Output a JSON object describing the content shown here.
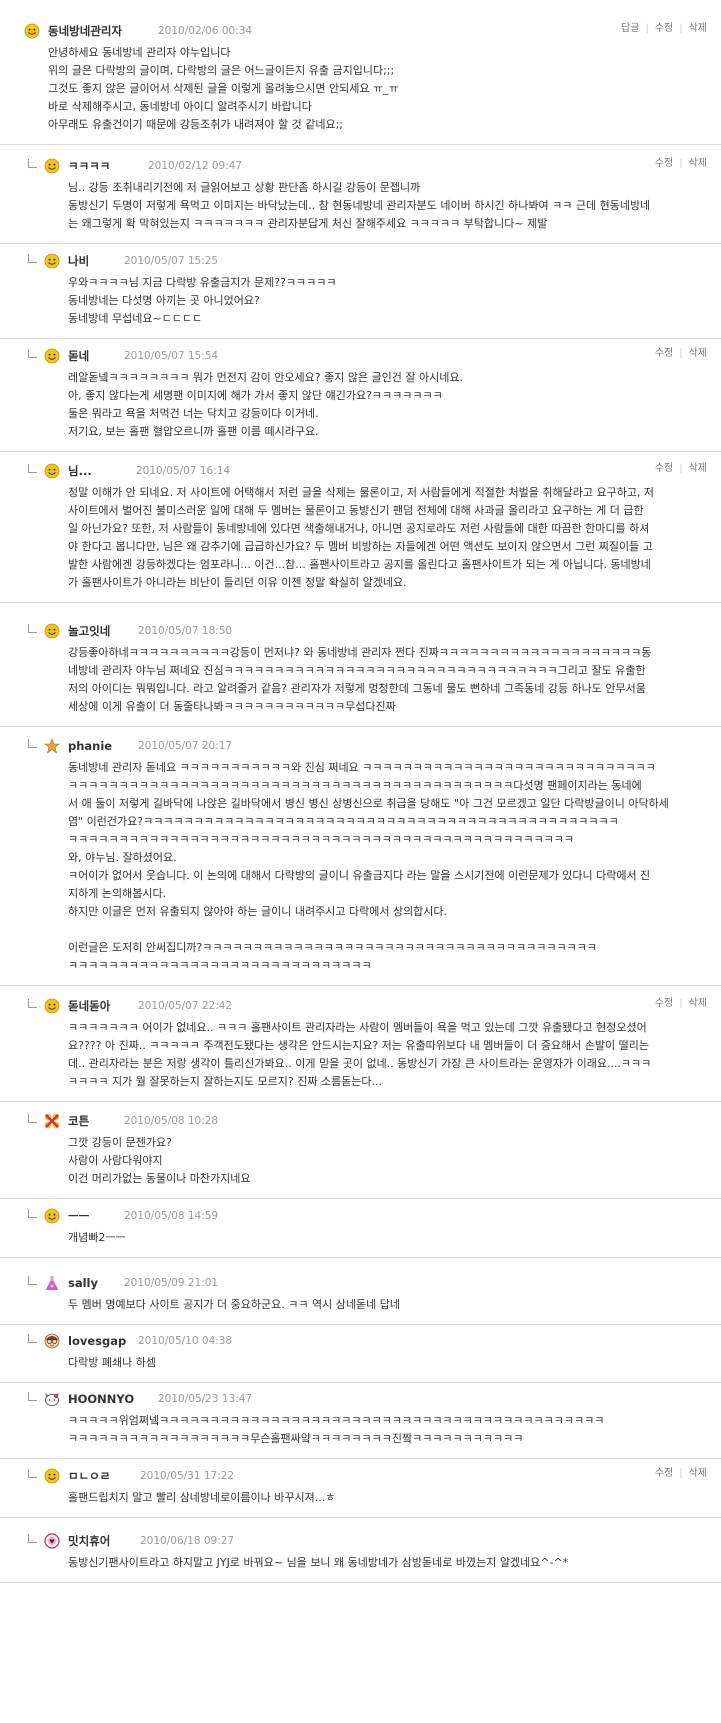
{
  "comments": [
    {
      "author": "동네방네관리자",
      "date": "2010/02/06 00:34",
      "avatar": "smiley-icon",
      "actions": [
        "답글",
        "수정",
        "삭제"
      ],
      "lines": [
        "안녕하세요 동네방네 관리자 야누입니다",
        "위의 글은 다락방의 글이며, 다락방의 글은 어느글이든지 유출 금지입니다;;;",
        "그것도 좋지 않은 글이어서 삭제된 글을 이렇게 올려놓으시면 안되세요 ㅠ_ㅠ",
        "바로 삭제해주시고, 동네방네 아이디 알려주시기 바랍니다",
        "아무래도 유출건이기 때문에 강등조취가 내려져야 할 것 같네요;;"
      ]
    },
    {
      "author": "ㅋㅋㅋㅋ",
      "date": "2010/02/12 09:47",
      "avatar": "smiley-icon",
      "actions": [
        "수정",
        "삭제"
      ],
      "lines": [
        "님.. 강등 조취내리기전에 저 글읽어보고 상황 판단좀 하시길 강등이 문젭니까",
        "동방신기 두명이 저렇게 욕먹고 이미지는 바닥났는데.. 참 현동네방네 관리자분도 네이버 하시긴 하나봐여 ㅋㅋ 근데 현동네방네",
        "는 왜그렇게 확 막혀있는지 ㅋㅋㅋㅋㅋㅋㅋ 관리자분답게 처신 잘해주세요 ㅋㅋㅋㅋㅋ 부탁합니다~ 제발"
      ]
    },
    {
      "author": "나비",
      "date": "2010/05/07 15:25",
      "avatar": "smiley-icon",
      "actions": [],
      "lines": [
        "우와ㅋㅋㅋㅋ님 지금 다락방 유출금지가 문제??ㅋㅋㅋㅋㅋ",
        "동네방네는 다섯명 아끼는 곳 아니었어요?",
        "동네방네 무섭네요~ㄷㄷㄷㄷ"
      ]
    },
    {
      "author": "돋네",
      "date": "2010/05/07 15:54",
      "avatar": "smiley-icon",
      "actions": [
        "수정",
        "삭제"
      ],
      "lines": [
        "레알돋넼ㅋㅋㅋㅋㅋㅋㅋㅋ 뭐가 먼전지 감이 안오세요? 좋지 않은 글인건 잘 아시네요.",
        "아, 좋지 않다는게 세명팬 이미지에 해가 가서 좋지 않단 얘긴가요?ㅋㅋㅋㅋㅋㅋㅋ",
        "둘은 뭐라고 욕을 처먹건 너는 닥치고 강등이다 이거네.",
        "저기요, 보는 홀팬 혈압오르니까 홀팬 이름 떼시라구요."
      ]
    },
    {
      "author": "님...",
      "date": "2010/05/07 16:14",
      "avatar": "smiley-icon",
      "actions": [
        "수정",
        "삭제"
      ],
      "lines": [
        "정말 이해가 안 되네요. 저 사이트에 어택해서 저런 글을 삭제는 물론이고, 저 사람들에게 적절한 처벌을 취해달라고 요구하고, 저",
        "사이트에서 벌어진 불미스러운 일에 대해 두 멤버는 물론이고 동방신기 팬덤 전체에 대해 사과글 올리라고 요구하는 게 더 급한",
        "일 아닌가요? 또한, 저 사람들이 동네방네에 있다면 색출해내거나, 아니면 공지로라도 저런 사람들에 대한 따끔한 한마디를 하셔",
        "야 한다고 봅니다만, 님은 왜 감추기에 급급하신가요? 두 멤버 비방하는 자들에겐 어떤 액션도 보이지 않으면서 그런 찌질이들 고",
        "발한 사람에겐 강등하겠다는 엄포라니... 이건...참... 홀팬사이트라고 공지를 올린다고 홀팬사이트가 되는 게 아닙니다. 동네방네",
        "가 홀팬사이트가 아니라는 비난이 들리던 이유 이젠 정말 확실히 알겠네요."
      ]
    },
    {
      "author": "놀고잇네",
      "date": "2010/05/07 18:50",
      "avatar": "smiley-icon",
      "actions": [],
      "lines": [
        "강등좋아하네ㅋㅋㅋㅋㅋㅋㅋㅋㅋㅋ강등이 먼저냐? 와 동네방네 관리자 쩐다 진짜ㅋㅋㅋㅋㅋㅋㅋㅋㅋㅋㅋㅋㅋㅋㅋㅋㅋㅋㅋㅋ동",
        "네방네 관리자 야누님 쩌네요 진심ㅋㅋㅋㅋㅋㅋㅋㅋㅋㅋㅋㅋㅋㅋㅋㅋㅋㅋㅋㅋㅋㅋㅋㅋㅋㅋㅋㅋㅋㅋㅋㅋㅋ그리고 잘도 유출한",
        "저의 아이디는 뭐뭐입니다. 라고 알려줄거 같음? 관리자가 저렇게 멍청한데 그동네 물도 뻔하네 그족동네 강등 하나도 안무서움",
        "세상에 이게 유출이 더 동줄타나봐ㅋㅋㅋㅋㅋㅋㅋㅋㅋㅋㅋㅋ무섭다진짜"
      ]
    },
    {
      "author": "phanie",
      "date": "2010/05/07 20:17",
      "avatar": "star-icon",
      "actions": [],
      "lines": [
        "동네방네 관리자 돋네요 ㅋㅋㅋㅋㅋㅋㅋㅋㅋㅋㅋ와 진심 쩌네요 ㅋㅋㅋㅋㅋㅋㅋㅋㅋㅋㅋㅋㅋㅋㅋㅋㅋㅋㅋㅋㅋㅋㅋㅋㅋㅋㅋㅋㅋ",
        "ㅋㅋㅋㅋㅋㅋㅋㅋㅋㅋㅋㅋㅋㅋㅋㅋㅋㅋㅋㅋㅋㅋㅋㅋㅋㅋㅋㅋㅋㅋㅋㅋㅋㅋㅋㅋㅋㅋㅋㅋㅋㅋㅋㅋ다섯명 팬페이지라는 동네에",
        "서 애 둘이 저렇게 길바닥에 나앉은 길바닥에서 병신 병신 상병신으로 취급을 당해도 \"아 그건 모르겠고 일단 다락방글이니 아닥하세",
        "염\" 이런건가요?ㅋㅋㅋㅋㅋㅋㅋㅋㅋㅋㅋㅋㅋㅋㅋㅋㅋㅋㅋㅋㅋㅋㅋㅋㅋㅋㅋㅋㅋㅋㅋㅋㅋㅋㅋㅋㅋㅋㅋㅋㅋㅋㅋㅋㅋㅋㅋ",
        "ㅋㅋㅋㅋㅋㅋㅋㅋㅋㅋㅋㅋㅋㅋㅋㅋㅋㅋㅋㅋㅋㅋㅋㅋㅋㅋㅋㅋㅋㅋㅋㅋㅋㅋㅋㅋㅋㅋㅋㅋㅋㅋㅋㅋㅋㅋㅋㅋㅋㅋ",
        "와, 야누님. 잘하셨어요.",
        "ㅋ어이가 없어서 웃습니다. 이 논의에 대해서 다락방의 글이니 유출금지다 라는 말을 스시기전에 이런문제가 있다니 다락에서 진",
        "지하게 논의해봅시다.",
        "하지만 이글은 먼저 유출되지 않아야 하는 글이니 내려주시고 다락에서 상의합시다.",
        "",
        "이런글은 도저히 안써집디까?ㅋㅋㅋㅋㅋㅋㅋㅋㅋㅋㅋㅋㅋㅋㅋㅋㅋㅋㅋㅋㅋㅋㅋㅋㅋㅋㅋㅋㅋㅋㅋㅋㅋㅋㅋㅋㅋㅋㅋ",
        "ㅋㅋㅋㅋㅋㅋㅋㅋㅋㅋㅋㅋㅋㅋㅋㅋㅋㅋㅋㅋㅋㅋㅋㅋㅋㅋㅋㅋㅋㅋ"
      ]
    },
    {
      "author": "돋네돋아",
      "date": "2010/05/07 22:42",
      "avatar": "smiley-icon",
      "actions": [
        "수정",
        "삭제"
      ],
      "lines": [
        "ㅋㅋㅋㅋㅋㅋㅋ 어이가 없네요.. ㅋㅋㅋ 홀팬사이트 관리자라는 사람이 멤버들이 욕을 먹고 있는데 그깟 유출됐다고 현정오셨어",
        "요???? 아 진짜.. ㅋㅋㅋㅋㅋ 주객전도됐다는 생각은 안드시는지요? 저는 유출따위보다 내 멤버들이 더 중요해서 손발이 떨리는",
        "데.. 관리자라는 분은 저랑 생각이 틀리신가봐요.. 이게 믿을 곳이 없네.. 동방신기 가장 큰 사이트라는 운영자가 이래요....ㅋㅋㅋ",
        "ㅋㅋㅋㅋ 지가 뭘 잘못하는지 잘하는지도 모르지? 진짜 소름돋는다..."
      ]
    },
    {
      "author": "코튼",
      "date": "2010/05/08 10:28",
      "avatar": "flower-icon",
      "actions": [],
      "lines": [
        "그깟 강등이 문젠가요?",
        "사람이 사람다워야지",
        "이건 머리가없는 동물이나 마찬가지네요"
      ]
    },
    {
      "author": "ㅡㅡ",
      "date": "2010/05/08 14:59",
      "avatar": "smiley-icon",
      "actions": [],
      "lines": [
        "개념빠2ㅡㅡ"
      ]
    },
    {
      "author": "sally",
      "date": "2010/05/09 21:01",
      "avatar": "flask-icon",
      "actions": [],
      "lines": [
        "두 멤버 명예보다 사이트 공지가 더 중요하군요. ㅋㅋ 역시 삼네돋네 답네"
      ]
    },
    {
      "author": "lovesgap",
      "date": "2010/05/10 04:38",
      "avatar": "face-glasses-icon",
      "actions": [],
      "lines": [
        "다락방 폐쇄나 하셈"
      ]
    },
    {
      "author": "HOONNYO",
      "date": "2010/05/23 13:47",
      "avatar": "kitty-icon",
      "actions": [],
      "lines": [
        "ㅋㅋㅋㅋㅋ위엄쩌넼ㅋㅋㅋㅋㅋㅋㅋㅋㅋㅋㅋㅋㅋㅋㅋㅋㅋㅋㅋㅋㅋㅋㅋㅋㅋㅋㅋㅋㅋㅋㅋㅋㅋㅋㅋㅋㅋㅋㅋㅋㅋㅋㅋㅋ",
        "ㅋㅋㅋㅋㅋㅋㅋㅋㅋㅋㅋㅋㅋㅋㅋㅋㅋㅋ무슨홀팬싸얔ㅋㅋㅋㅋㅋㅋㅋㅋ진짴ㅋㅋㅋㅋㅋㅋㅋㅋㅋㅋㅋ"
      ]
    },
    {
      "author": "ㅁㄴㅇㄹ",
      "date": "2010/05/31 17:22",
      "avatar": "smiley-icon",
      "actions": [
        "수정",
        "삭제"
      ],
      "lines": [
        "홀팬드립치지 말고 빨리 삼네방네로이름이나 바꾸시져...ㅎ"
      ]
    },
    {
      "author": "밋치휴어",
      "date": "2010/06/18 09:27",
      "avatar": "badge-icon",
      "actions": [],
      "lines": [
        "동방신기팬사이트라고 하지말고 JYJ로 바꿔요~ 님을 보니 왜 동네방네가 삼방돋네로 바꼈는지 알겠네요^-^*"
      ]
    }
  ]
}
